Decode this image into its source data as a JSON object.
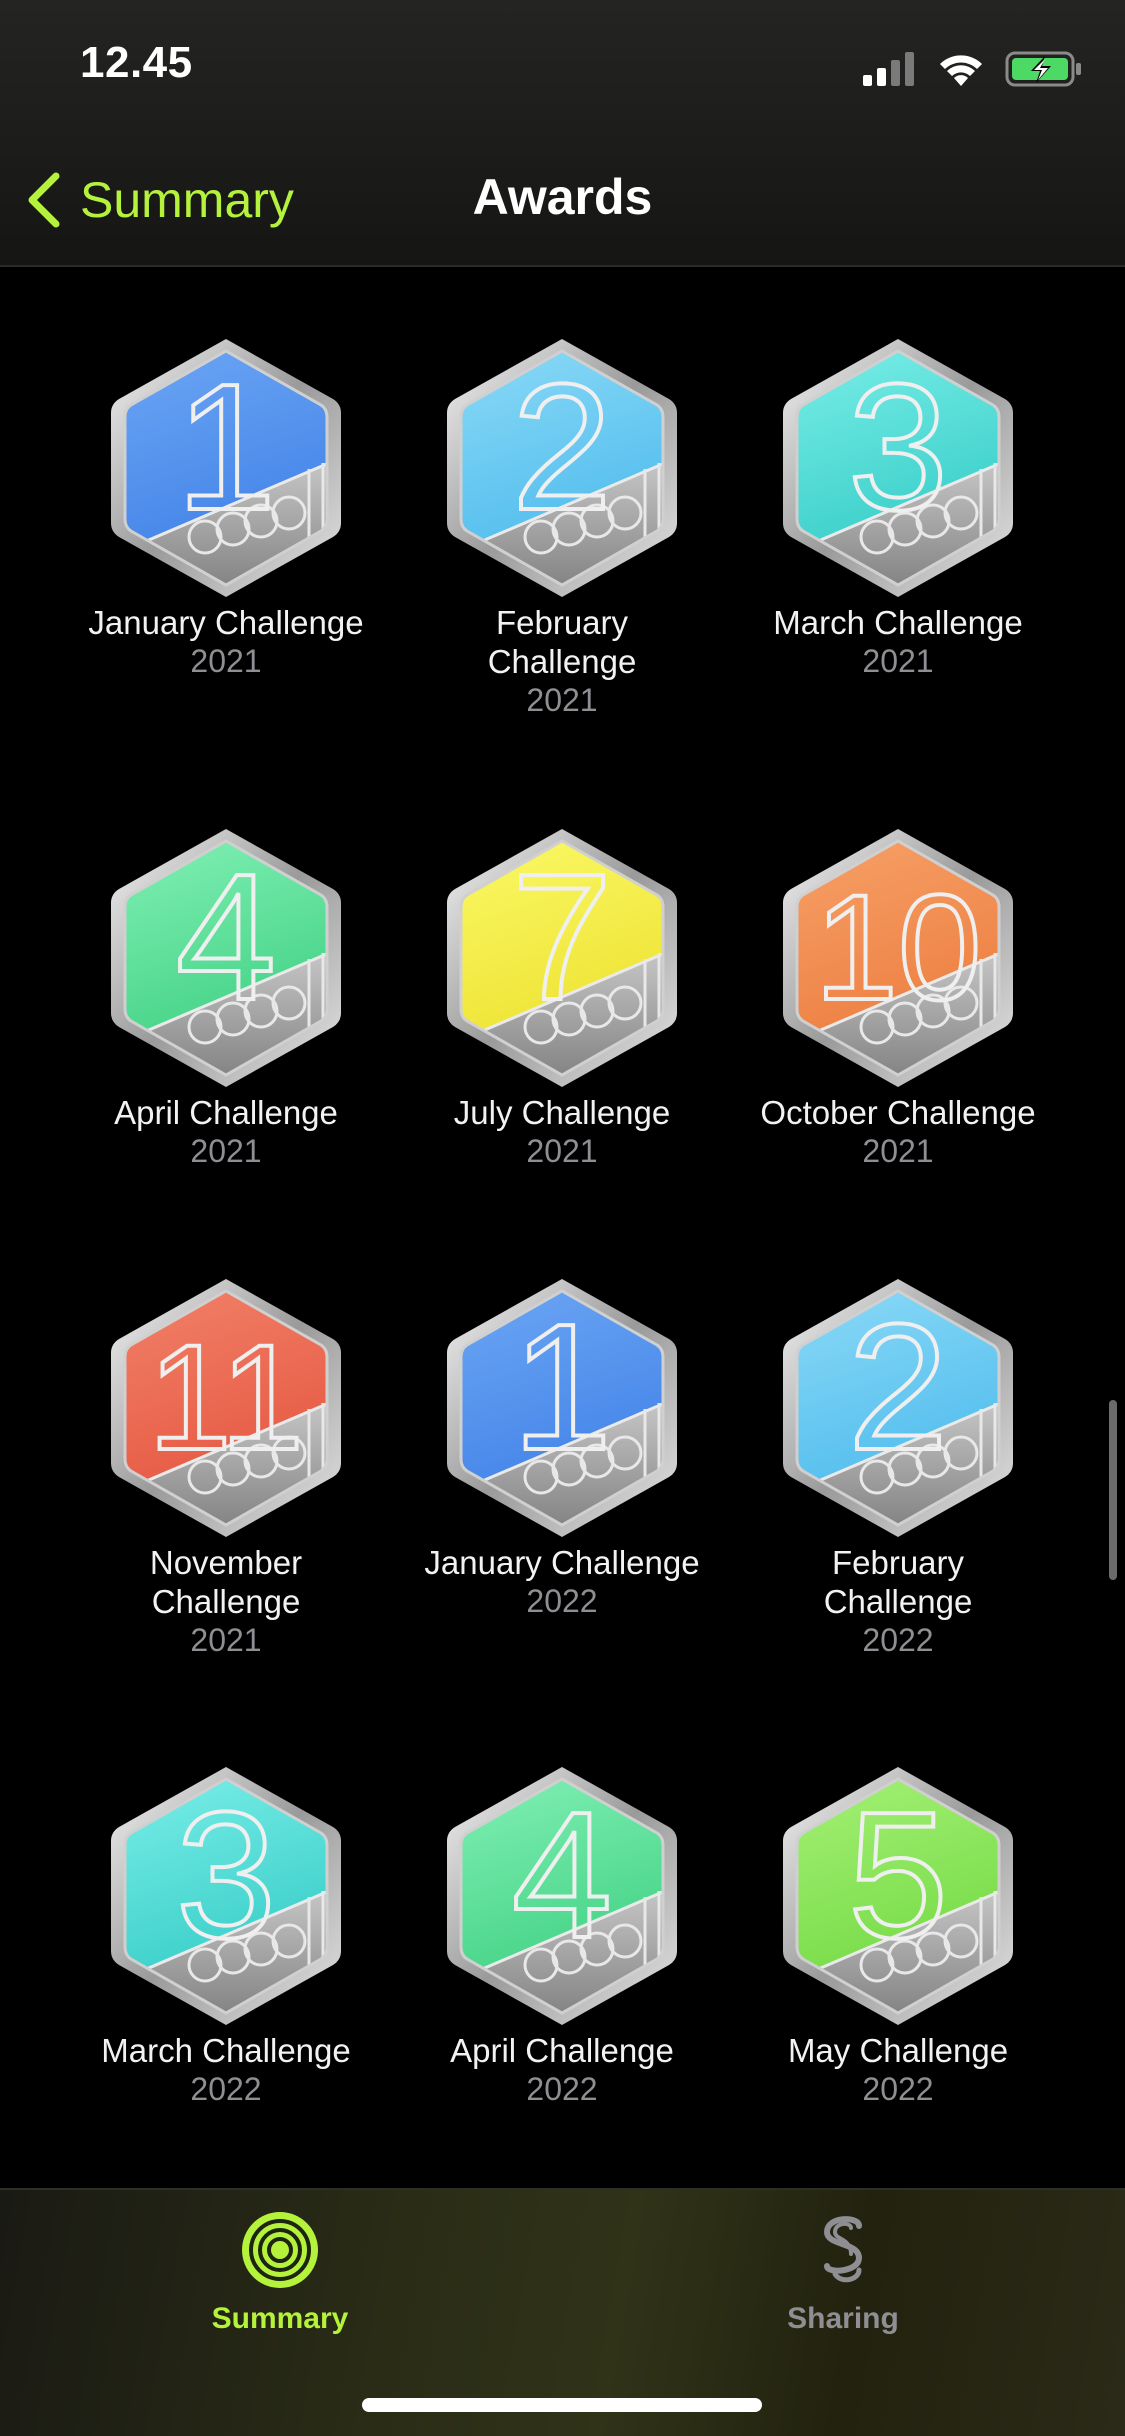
{
  "status": {
    "time": "12.45"
  },
  "nav": {
    "back_label": "Summary",
    "title": "Awards"
  },
  "awards": [
    {
      "name": "January Challenge",
      "year": "2021",
      "numeral": "1",
      "color_top": "#6fa8f5",
      "color_bottom": "#3d7fe6"
    },
    {
      "name": "February Challenge",
      "year": "2021",
      "numeral": "2",
      "color_top": "#8fdcf7",
      "color_bottom": "#49b8ec"
    },
    {
      "name": "March Challenge",
      "year": "2021",
      "numeral": "3",
      "color_top": "#7ff0ea",
      "color_bottom": "#2fc9c4"
    },
    {
      "name": "April Challenge",
      "year": "2021",
      "numeral": "4",
      "color_top": "#86f2b8",
      "color_bottom": "#3bce7f"
    },
    {
      "name": "July Challenge",
      "year": "2021",
      "numeral": "7",
      "color_top": "#fbfa6a",
      "color_bottom": "#ece02c"
    },
    {
      "name": "October Challenge",
      "year": "2021",
      "numeral": "10",
      "color_top": "#f7a36a",
      "color_bottom": "#ec7a3c"
    },
    {
      "name": "November Challenge",
      "year": "2021",
      "numeral": "11",
      "color_top": "#f2846b",
      "color_bottom": "#e5533d"
    },
    {
      "name": "January Challenge",
      "year": "2022",
      "numeral": "1",
      "color_top": "#6fa8f5",
      "color_bottom": "#3d7fe6"
    },
    {
      "name": "February Challenge",
      "year": "2022",
      "numeral": "2",
      "color_top": "#8fdcf7",
      "color_bottom": "#49b8ec"
    },
    {
      "name": "March Challenge",
      "year": "2022",
      "numeral": "3",
      "color_top": "#7ff0ea",
      "color_bottom": "#2fc9c4"
    },
    {
      "name": "April Challenge",
      "year": "2022",
      "numeral": "4",
      "color_top": "#86f2b8",
      "color_bottom": "#3bce7f"
    },
    {
      "name": "May Challenge",
      "year": "2022",
      "numeral": "5",
      "color_top": "#a8f279",
      "color_bottom": "#6fd83f"
    }
  ],
  "tabs": [
    {
      "label": "Summary",
      "icon": "activity-rings-icon",
      "active": true
    },
    {
      "label": "Sharing",
      "icon": "sharing-icon",
      "active": false
    }
  ],
  "colors": {
    "accent": "#b5f23c",
    "inactive": "#8e8e93"
  }
}
